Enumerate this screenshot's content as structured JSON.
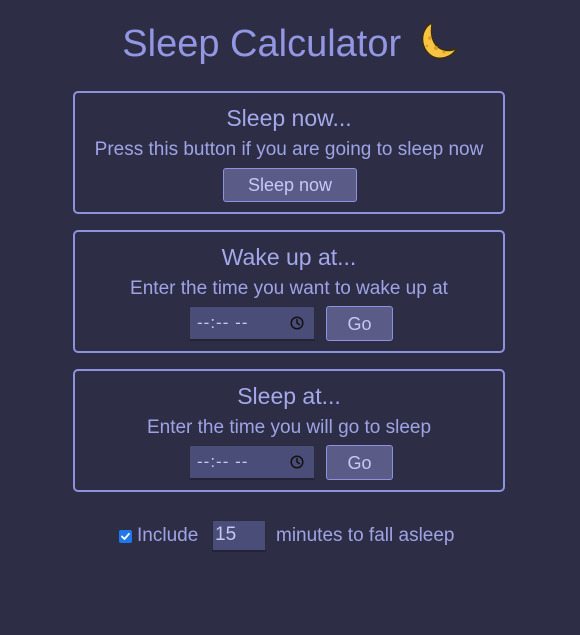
{
  "header": {
    "title": "Sleep Calculator",
    "icon": "crescent-moon-icon"
  },
  "sleep_now": {
    "title": "Sleep now...",
    "description": "Press this button if you are going to sleep now",
    "button_label": "Sleep now"
  },
  "wake_up": {
    "title": "Wake up at...",
    "description": "Enter the time you want to wake up at",
    "time_value": "--:-- --",
    "button_label": "Go"
  },
  "sleep_at": {
    "title": "Sleep at...",
    "description": "Enter the time you will go to sleep",
    "time_value": "--:-- --",
    "button_label": "Go"
  },
  "footer": {
    "include_checked": true,
    "include_label": "Include",
    "minutes_value": "15",
    "minutes_suffix": "minutes to fall asleep"
  },
  "colors": {
    "background": "#2d2e45",
    "accent": "#8e91de",
    "text": "#a4a8ea",
    "button": "#5a5c87",
    "input": "#4b4d79",
    "checkbox": "#1f77ea"
  }
}
